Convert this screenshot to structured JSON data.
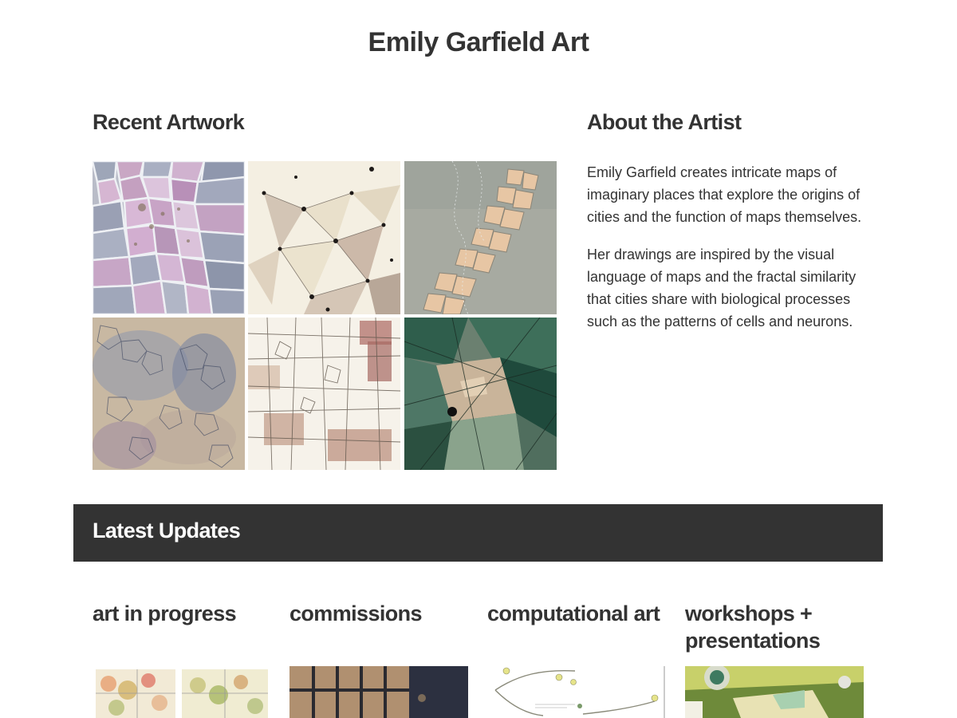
{
  "site": {
    "title": "Emily Garfield Art"
  },
  "recent": {
    "heading": "Recent Artwork",
    "tiles": [
      {
        "name": "pink-cell-map-artwork"
      },
      {
        "name": "star-network-artwork"
      },
      {
        "name": "grey-wash-cells-artwork"
      },
      {
        "name": "blue-lattice-artwork"
      },
      {
        "name": "brown-street-grid-artwork"
      },
      {
        "name": "green-geometric-artwork"
      }
    ]
  },
  "about": {
    "heading": "About the Artist",
    "paragraphs": [
      "Emily Garfield creates intricate maps of imaginary places that explore the origins of cities and the function of maps themselves.",
      "Her drawings are inspired by the visual language of maps and the fractal similarity that cities share with biological processes such as the patterns of cells and neurons."
    ]
  },
  "updates": {
    "heading": "Latest Updates",
    "categories": [
      {
        "title": "art in progress"
      },
      {
        "title": "commissions"
      },
      {
        "title": "computational art"
      },
      {
        "title": "workshops + presentations"
      }
    ]
  },
  "colors": {
    "text": "#333333",
    "bar_bg": "#333333",
    "bar_text": "#ffffff",
    "background": "#ffffff"
  }
}
